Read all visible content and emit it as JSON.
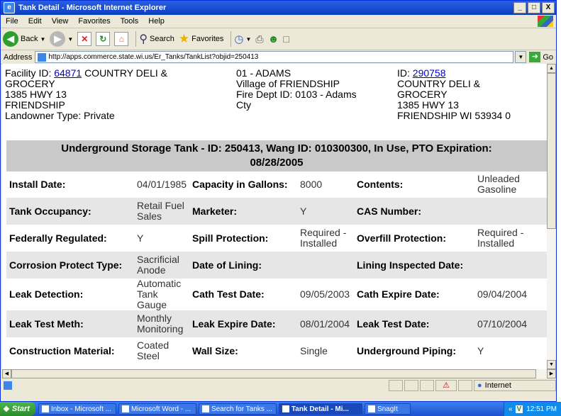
{
  "window": {
    "title": "Tank Detail - Microsoft Internet Explorer",
    "btn_min": "_",
    "btn_max": "□",
    "btn_close": "X"
  },
  "menu": {
    "file": "File",
    "edit": "Edit",
    "view": "View",
    "favorites": "Favorites",
    "tools": "Tools",
    "help": "Help"
  },
  "toolbar": {
    "back": "Back",
    "search": "Search",
    "favorites": "Favorites"
  },
  "address": {
    "label": "Address",
    "url": "http://apps.commerce.state.wi.us/Er_Tanks/TankList?objid=250413",
    "go": "Go"
  },
  "facility": {
    "id_label": "Facility ID:",
    "id": "64871",
    "name1": "COUNTRY DELI &",
    "name2": "GROCERY",
    "street": "1385 HWY 13",
    "city": "FRIENDSHIP",
    "landowner": "Landowner Type: Private",
    "county": "01 - ADAMS",
    "village": "Village of FRIENDSHIP",
    "fire1": "Fire Dept ID: 0103 - Adams",
    "fire2": "Cty",
    "owner_id_label": "ID:",
    "owner_id": "290758",
    "owner_name1": "COUNTRY DELI &",
    "owner_name2": "GROCERY",
    "owner_street": "1385 HWY 13",
    "owner_city": "FRIENDSHIP WI 53934 0"
  },
  "banner": {
    "line1": "Underground Storage Tank - ID: 250413, Wang ID: 010300300, In Use, PTO Expiration:",
    "line2": "08/28/2005"
  },
  "rows": [
    {
      "l1": "Install Date:",
      "v1": "04/01/1985",
      "l2": "Capacity in Gallons:",
      "v2": "8000",
      "l3": "Contents:",
      "v3": "Unleaded Gasoline"
    },
    {
      "l1": "Tank Occupancy:",
      "v1": "Retail Fuel Sales",
      "l2": "Marketer:",
      "v2": "Y",
      "l3": "CAS Number:",
      "v3": ""
    },
    {
      "l1": "Federally Regulated:",
      "v1": "Y",
      "l2": "Spill Protection:",
      "v2": "Required - Installed",
      "l3": "Overfill Protection:",
      "v3": "Required - Installed"
    },
    {
      "l1": "Corrosion Protect Type:",
      "v1": "Sacrificial Anode",
      "l2": "Date of Lining:",
      "v2": "",
      "l3": "Lining Inspected Date:",
      "v3": ""
    },
    {
      "l1": "Leak Detection:",
      "v1": "Automatic Tank Gauge",
      "l2": "Cath Test Date:",
      "v2": "09/05/2003",
      "l3": "Cath Expire Date:",
      "v3": "09/04/2004"
    },
    {
      "l1": "Leak Test Meth:",
      "v1": "Monthly Monitoring",
      "l2": "Leak Expire Date:",
      "v2": "08/01/2004",
      "l3": "Leak Test Date:",
      "v3": "07/10/2004"
    },
    {
      "l1": "Construction Material:",
      "v1": "Coated Steel",
      "l2": "Wall Size:",
      "v2": "Single",
      "l3": "Underground Piping:",
      "v3": "Y"
    }
  ],
  "status": {
    "zone": "Internet"
  },
  "taskbar": {
    "start": "Start",
    "items": [
      "Inbox - Microsoft ...",
      "Microsoft Word - ...",
      "Search for Tanks ...",
      "Tank Detail - Mi...",
      "SnagIt"
    ],
    "clock": "12:51 PM"
  },
  "colors": {
    "title_bar": "#0a3fc4",
    "banner_bg": "#c9c9c9",
    "link": "#0000cc"
  }
}
